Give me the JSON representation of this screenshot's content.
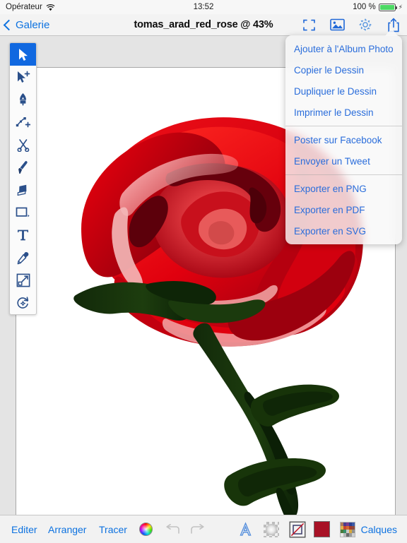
{
  "status_bar": {
    "carrier": "Opérateur",
    "wifi_icon": "wifi-icon",
    "time": "13:52",
    "battery_percent": "100 %",
    "battery_icon": "battery-full-icon",
    "charging_icon": "lightning-bolt-icon"
  },
  "nav_bar": {
    "back_label": "Galerie",
    "back_icon": "chevron-left-icon",
    "title": "tomas_arad_red_rose @ 43%",
    "icons": [
      {
        "name": "fit-to-screen-icon",
        "label": "Ajuster"
      },
      {
        "name": "image-icon",
        "label": "Image"
      },
      {
        "name": "gear-icon",
        "label": "Réglages"
      },
      {
        "name": "share-icon",
        "label": "Partager"
      }
    ]
  },
  "tool_palette": {
    "tools": [
      {
        "name": "select-tool",
        "icon": "arrow-cursor-icon",
        "active": true
      },
      {
        "name": "direct-select-tool",
        "icon": "arrow-cursor-plus-icon",
        "active": false
      },
      {
        "name": "pen-tool",
        "icon": "pen-nib-icon",
        "active": false
      },
      {
        "name": "add-node-tool",
        "icon": "node-path-plus-icon",
        "active": false
      },
      {
        "name": "scissors-tool",
        "icon": "scissors-icon",
        "active": false
      },
      {
        "name": "brush-tool",
        "icon": "paintbrush-icon",
        "active": false
      },
      {
        "name": "eraser-tool",
        "icon": "eraser-icon",
        "active": false
      },
      {
        "name": "shape-tool",
        "icon": "rectangle-icon",
        "active": false
      },
      {
        "name": "text-tool",
        "icon": "text-t-icon",
        "active": false
      },
      {
        "name": "eyedropper-tool",
        "icon": "eyedropper-icon",
        "active": false
      },
      {
        "name": "scale-tool",
        "icon": "scale-arrow-icon",
        "active": false
      },
      {
        "name": "rotate-tool",
        "icon": "rotate-icon",
        "active": false
      }
    ]
  },
  "share_popover": {
    "groups": [
      [
        "Ajouter à l'Album Photo",
        "Copier le Dessin",
        "Dupliquer le Dessin",
        "Imprimer le Dessin"
      ],
      [
        "Poster sur Facebook",
        "Envoyer un Tweet"
      ],
      [
        "Exporter en PNG",
        "Exporter en PDF",
        "Exporter en SVG"
      ]
    ],
    "items": [
      "Ajouter à l'Album Photo",
      "Copier le Dessin",
      "Dupliquer le Dessin",
      "Imprimer le Dessin",
      "Poster sur Facebook",
      "Envoyer un Tweet",
      "Exporter en PNG",
      "Exporter en PDF",
      "Exporter en SVG"
    ]
  },
  "bottom_bar": {
    "edit_label": "Editer",
    "arrange_label": "Arranger",
    "trace_label": "Tracer",
    "layers_label": "Calques",
    "color_wheel_icon": "color-wheel-icon",
    "undo_icon": "undo-arrow-icon",
    "redo_icon": "redo-arrow-icon",
    "font_icon": "font-a-icon",
    "opacity_icon": "opacity-gradient-icon",
    "stroke_icon": "stroke-shape-icon",
    "fill_swatch_icon": "fill-color-swatch",
    "palette_icon": "color-palette-icon",
    "fill_color": "#a81226",
    "accent_color": "#0d72e0",
    "palette_colors": [
      "#b07a5a",
      "#4b3b8f",
      "#7a3b8f",
      "#2b3f8f",
      "#3b5aa8",
      "#e0b24a",
      "#c8452f",
      "#d46a2f",
      "#a83a2a",
      "#8f4a3a",
      "#4a7a3a",
      "#3a8f6a",
      "#c8c8c8",
      "#d8a83a",
      "#8f8f8f",
      "#e8e8e8",
      "#b8b8b8",
      "#6a6a6a",
      "#9a9a9a",
      "#d0d0d0"
    ]
  },
  "canvas": {
    "document_name": "tomas_arad_red_rose",
    "zoom": "43%",
    "artwork": "red-rose-vector",
    "rose_colors": {
      "petal_bright": "#e8000d",
      "petal_mid": "#cc0010",
      "petal_dark": "#8e0012",
      "petal_shadow": "#6b000f",
      "highlight": "#f7b8b8",
      "leaf_dark": "#16300a",
      "leaf_mid": "#1e3d0e",
      "page_background": "#ffffff"
    }
  }
}
